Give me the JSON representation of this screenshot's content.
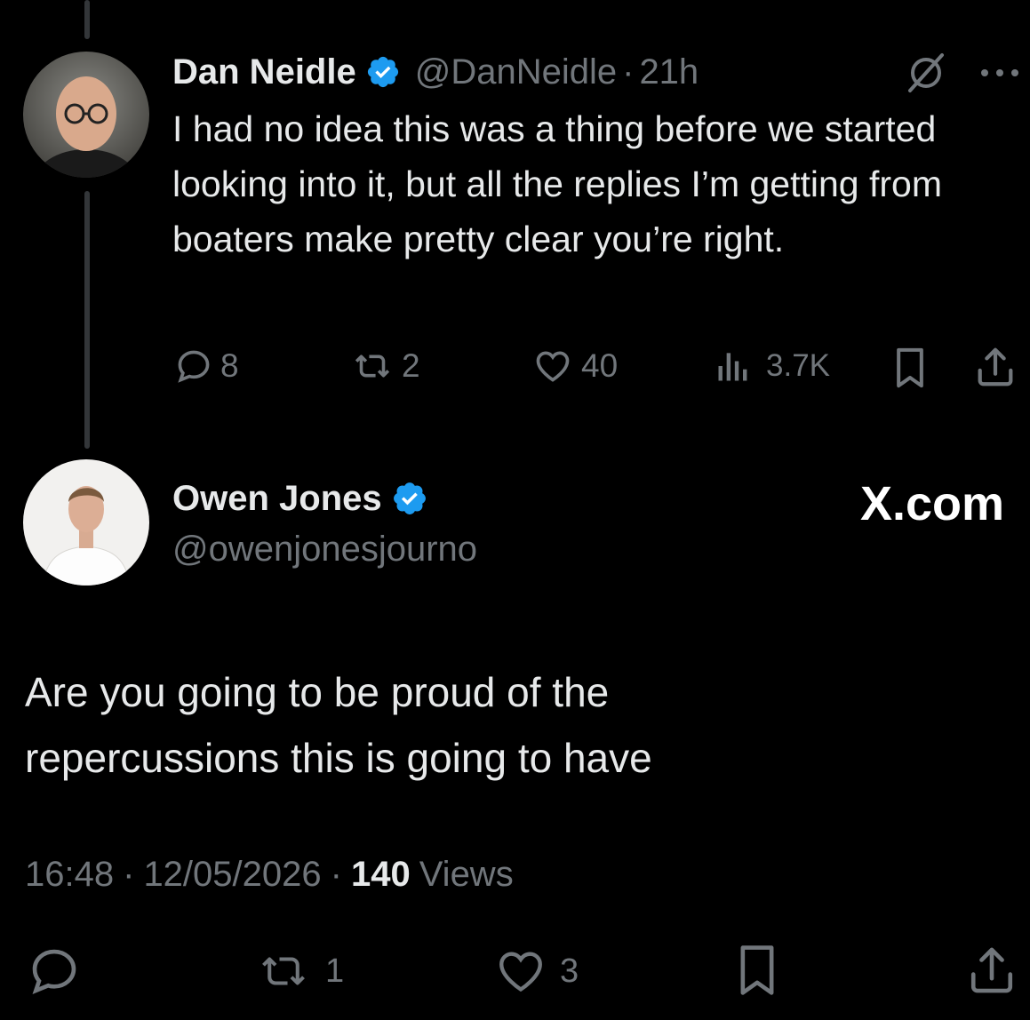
{
  "parent_tweet": {
    "author_name": "Dan Neidle",
    "handle": "@DanNeidle",
    "separator": "·",
    "time": "21h",
    "text": "I had no idea this was a thing before we started looking into it, but all the replies I’m getting from boaters make pretty clear you’re right.",
    "replies": "8",
    "retweets": "2",
    "likes": "40",
    "views": "3.7K"
  },
  "main_tweet": {
    "author_name": "Owen Jones",
    "handle": "@owenjonesjourno",
    "brand": "X.com",
    "text_line1": "Are you going to be proud of the",
    "text_line2": "repercussions this is going to have",
    "time": "16:48",
    "date": "12/05/2026",
    "separator": "·",
    "views_count": "140",
    "views_label": "Views",
    "retweets": "1",
    "likes": "3"
  },
  "colors": {
    "background": "#000000",
    "text": "#e7e9ea",
    "muted": "#71767b",
    "verified": "#1d9bf0"
  }
}
